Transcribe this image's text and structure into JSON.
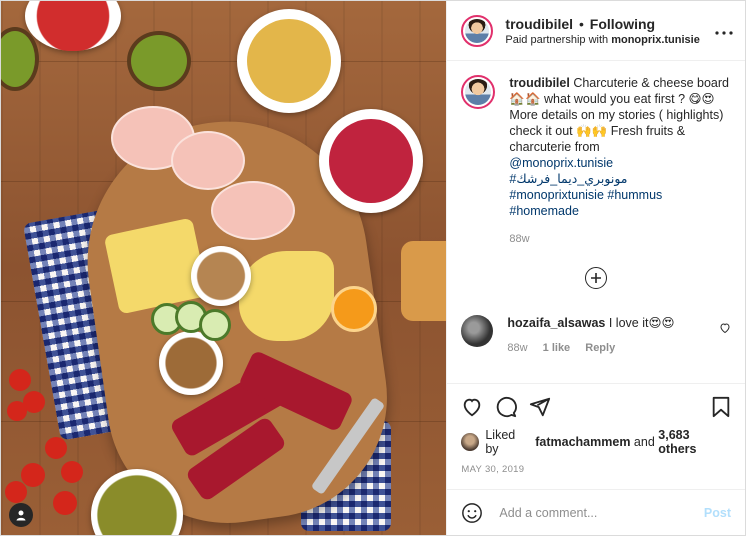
{
  "header": {
    "username": "troudibilel",
    "separator": "•",
    "follow_label": "Following",
    "partnership_prefix": "Paid partnership with",
    "partner": "monoprix.tunisie",
    "more_icon": "ellipsis-icon"
  },
  "caption": {
    "username": "troudibilel",
    "text1": "Charcuterie & cheese board 🏠🏠 what would you eat first ? 😋😍",
    "text2": "More details on my stories ( highlights) check it out 🙌🙌 Fresh fruits & charcuterie from",
    "mention": "@monoprix.tunisie",
    "hashtag_ar": "#مونوبري_ديما_فرشك",
    "hashtag1": "#monoprixtunisie",
    "hashtag2": "#hummus",
    "hashtag3": "#homemade",
    "age": "88w"
  },
  "load_more_icon": "plus-circle-icon",
  "comment": {
    "username": "hozaifa_alsawas",
    "text": "I love it😍😍",
    "age": "88w",
    "likes": "1 like",
    "reply": "Reply"
  },
  "likes": {
    "prefix": "Liked by",
    "user": "fatmachammem",
    "and": "and",
    "others": "3,683 others"
  },
  "date": "MAY 30, 2019",
  "add_comment": {
    "placeholder": "Add a comment...",
    "post_label": "Post"
  },
  "colors": {
    "story_ring": "#e1306c",
    "link": "#00376b",
    "post_disabled": "#b2dffc",
    "muted": "#8e8e8e"
  }
}
